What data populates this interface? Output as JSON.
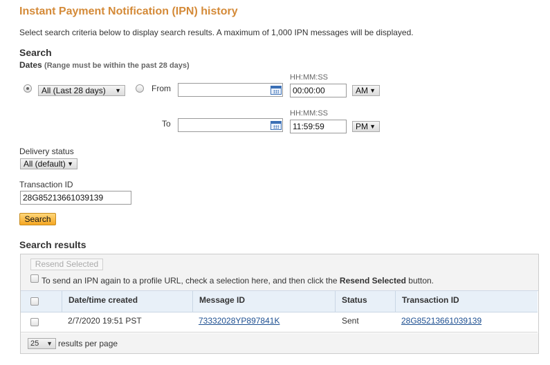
{
  "page": {
    "title": "Instant Payment Notification (IPN) history",
    "intro": "Select search criteria below to display search results. A maximum of 1,000 IPN messages will be displayed."
  },
  "search": {
    "heading": "Search",
    "dates_label": "Dates",
    "dates_hint": "(Range must be within the past 28 days)",
    "range_select": "All (Last 28 days)",
    "from_label": "From",
    "to_label": "To",
    "time_format_label": "HH:MM:SS",
    "from_date": "",
    "from_time": "00:00:00",
    "from_ampm": "AM",
    "to_date": "",
    "to_time": "11:59:59",
    "to_ampm": "PM",
    "delivery_status_label": "Delivery status",
    "delivery_status_value": "All (default)",
    "transaction_id_label": "Transaction ID",
    "transaction_id_value": "28G85213661039139",
    "search_button": "Search"
  },
  "results": {
    "heading": "Search results",
    "resend_button": "Resend Selected",
    "resend_note_pre": "To send an IPN again to a profile URL, check a selection here, and then click the ",
    "resend_note_bold": "Resend Selected",
    "resend_note_post": " button.",
    "columns": [
      "Date/time created",
      "Message ID",
      "Status",
      "Transaction ID"
    ],
    "rows": [
      {
        "date": "2/7/2020 19:51 PST",
        "message_id": "73332028YP897841K",
        "status": "Sent",
        "transaction_id": "28G85213661039139"
      }
    ],
    "per_page_value": "25",
    "per_page_label": "results per page"
  },
  "icons": {
    "calendar": "calendar-icon",
    "dropdown": "chevron-down-icon"
  },
  "colors": {
    "title": "#d48a38",
    "search_button": "#f5a623",
    "link": "#1d4f91",
    "table_header": "#e8f0f8"
  }
}
